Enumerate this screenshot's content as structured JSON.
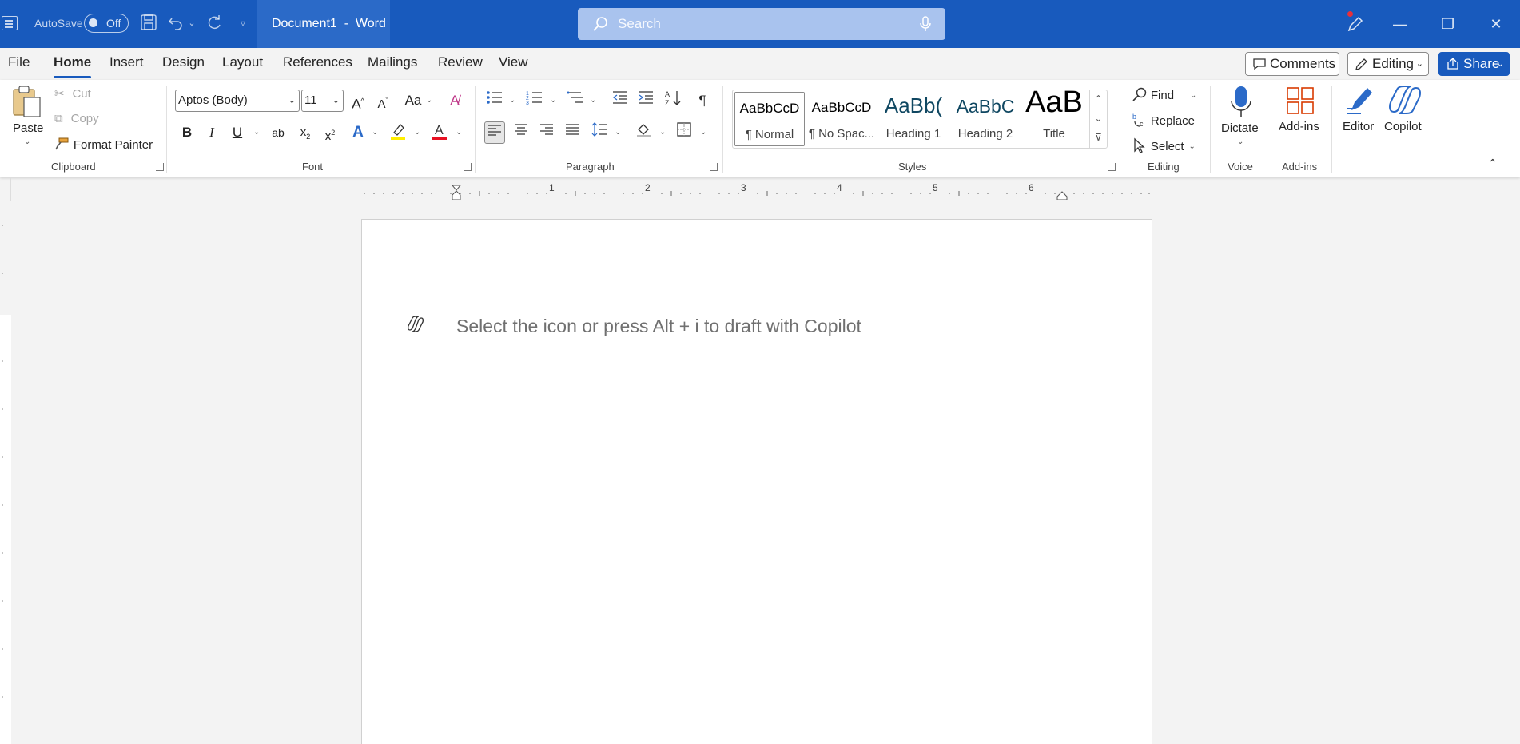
{
  "window": {
    "title": "Document1  -  Word",
    "autosave_label": "AutoSave",
    "autosave_state": "Off",
    "search_placeholder": "Search",
    "accent_color": "#185abd"
  },
  "tabs": [
    "File",
    "Home",
    "Insert",
    "Design",
    "Layout",
    "References",
    "Mailings",
    "Review",
    "View"
  ],
  "active_tab": "Home",
  "right_buttons": {
    "comments": "Comments",
    "editing": "Editing",
    "share": "Share"
  },
  "clipboard": {
    "paste": "Paste",
    "cut": "Cut",
    "copy": "Copy",
    "format_painter": "Format Painter",
    "group_label": "Clipboard"
  },
  "font": {
    "font_name": "Aptos (Body)",
    "font_size": "11",
    "change_case": "Aa",
    "group_label": "Font"
  },
  "paragraph": {
    "group_label": "Paragraph"
  },
  "styles": {
    "group_label": "Styles",
    "items": [
      {
        "sample": "AaBbCcD",
        "name": "¶ Normal"
      },
      {
        "sample": "AaBbCcD",
        "name": "¶ No Spac..."
      },
      {
        "sample": "AaBb(",
        "name": "Heading 1"
      },
      {
        "sample": "AaBbC",
        "name": "Heading 2"
      },
      {
        "sample": "AaB",
        "name": "Title"
      }
    ]
  },
  "editing": {
    "find": "Find",
    "replace": "Replace",
    "select": "Select",
    "group_label": "Editing"
  },
  "voice": {
    "dictate": "Dictate",
    "group_label": "Voice"
  },
  "addins": {
    "addins": "Add-ins",
    "group_label": "Add-ins"
  },
  "copilot_group": {
    "editor": "Editor",
    "copilot": "Copilot"
  },
  "ruler_numbers": [
    "1",
    "2",
    "3",
    "4",
    "5",
    "6"
  ],
  "document": {
    "copilot_hint": "Select the icon or press Alt + i to draft with Copilot"
  }
}
